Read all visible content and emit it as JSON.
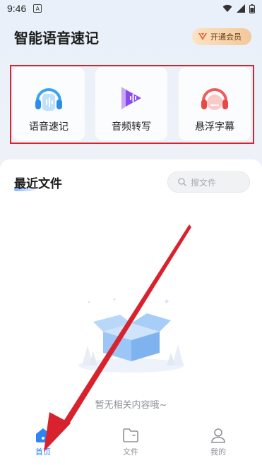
{
  "status_bar": {
    "time": "9:46",
    "badge": "A"
  },
  "header": {
    "title": "智能语音速记",
    "vip_label": "开通会员"
  },
  "tools": [
    {
      "label": "语音速记",
      "icon": "headphones-icon"
    },
    {
      "label": "音频转写",
      "icon": "audio-play-icon"
    },
    {
      "label": "悬浮字幕",
      "icon": "floating-caption-icon"
    }
  ],
  "recent": {
    "title": "最近文件",
    "search_placeholder": "搜文件",
    "empty_text": "暂无相关内容哦~"
  },
  "tabs": [
    {
      "label": "首页",
      "icon": "home-icon",
      "active": true
    },
    {
      "label": "文件",
      "icon": "folder-icon",
      "active": false
    },
    {
      "label": "我的",
      "icon": "user-icon",
      "active": false
    }
  ],
  "colors": {
    "accent": "#2f84f5",
    "annotation_red": "#d8232f",
    "vip_text": "#6b3d12"
  }
}
